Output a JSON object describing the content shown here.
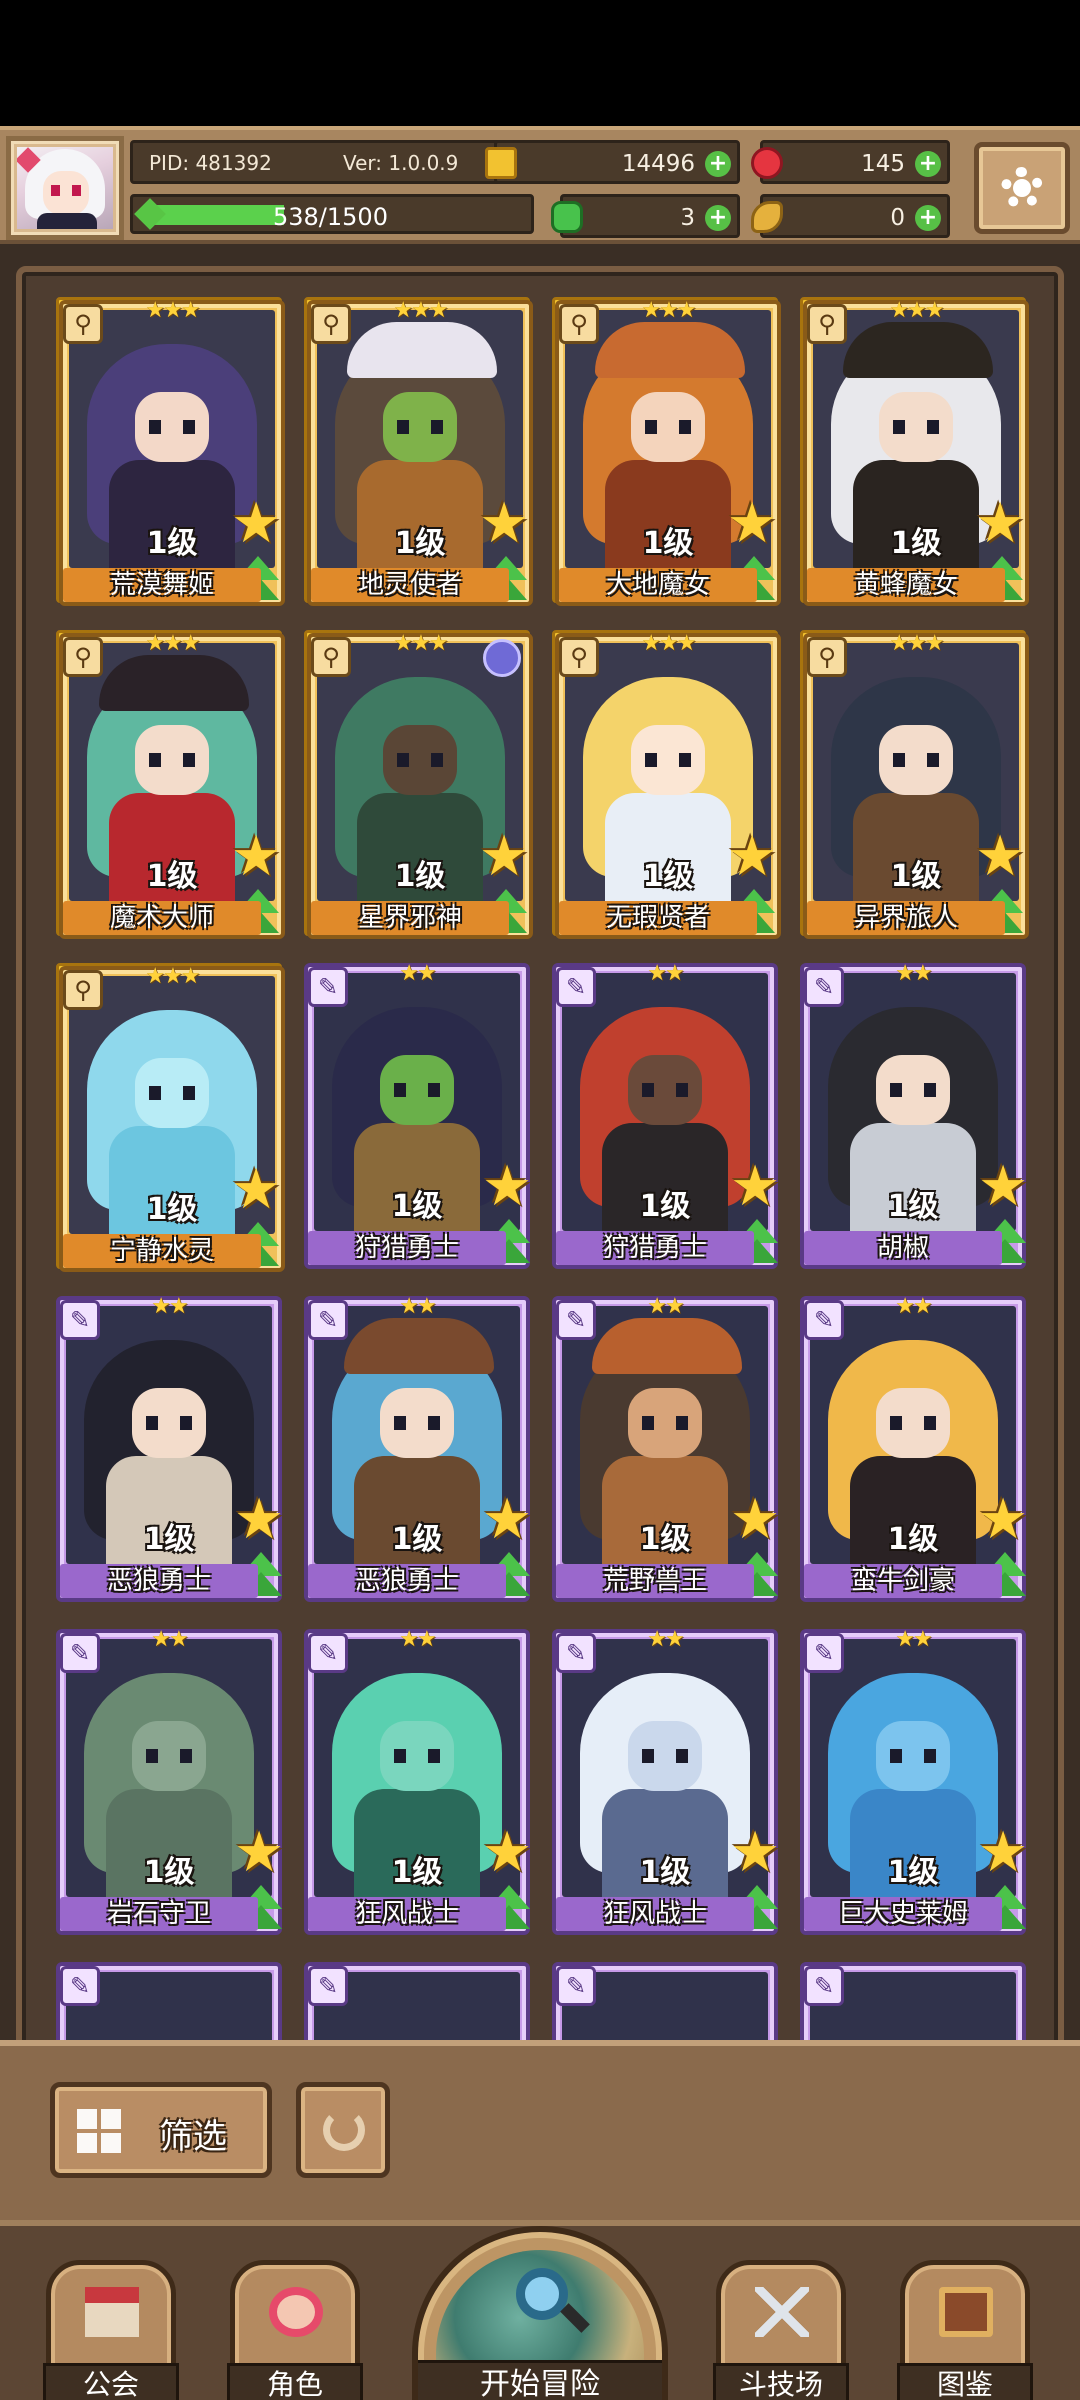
{
  "header": {
    "pid": "PID: 481392",
    "version": "Ver: 1.0.0.9",
    "xp": "538/1500",
    "xp_fraction": 0.359,
    "gold": "14496",
    "ruby": "145",
    "clover": "3",
    "horn": "0"
  },
  "cards": [
    {
      "name": "荒漠舞姬",
      "level": "1级",
      "frame": "gold",
      "stars": "★★★",
      "hair": "#4b3f7a",
      "skin": "#f3d8c8",
      "outfit": "#2d2540",
      "hat": ""
    },
    {
      "name": "地灵使者",
      "level": "1级",
      "frame": "gold",
      "stars": "★★★",
      "hair": "#5b4a3c",
      "skin": "#7fb24a",
      "outfit": "#a86a2e",
      "hat": "#e8e4ee"
    },
    {
      "name": "大地魔女",
      "level": "1级",
      "frame": "gold",
      "stars": "★★★",
      "hair": "#d47a2e",
      "skin": "#f4d4bc",
      "outfit": "#8a3a1e",
      "hat": "#c86a30"
    },
    {
      "name": "黄蜂魔女",
      "level": "1级",
      "frame": "gold",
      "stars": "★★★",
      "hair": "#e8e8ec",
      "skin": "#f3dccb",
      "outfit": "#2a2420",
      "hat": "#2c2620"
    },
    {
      "name": "魔术大师",
      "level": "1级",
      "frame": "gold",
      "stars": "★★★",
      "hair": "#5fb8a0",
      "skin": "#f3dccb",
      "outfit": "#b8282e",
      "hat": "#2a2228"
    },
    {
      "name": "星界邪神",
      "level": "1级",
      "frame": "gold",
      "stars": "★★★",
      "hair": "#3f7a62",
      "skin": "#5a4636",
      "outfit": "#2f4a3a",
      "hat": ""
    },
    {
      "name": "无瑕贤者",
      "level": "1级",
      "frame": "gold",
      "stars": "★★★",
      "hair": "#f4d36a",
      "skin": "#fbe6d4",
      "outfit": "#e8eef6",
      "hat": ""
    },
    {
      "name": "异界旅人",
      "level": "1级",
      "frame": "gold",
      "stars": "★★★",
      "hair": "#2e3648",
      "skin": "#f3dccb",
      "outfit": "#6a4a30",
      "hat": ""
    },
    {
      "name": "宁静水灵",
      "level": "1级",
      "frame": "gold",
      "stars": "★★★",
      "hair": "#8fd8ec",
      "skin": "#b8ecf6",
      "outfit": "#6cc6e0",
      "hat": ""
    },
    {
      "name": "狩猎勇士",
      "level": "1级",
      "frame": "purple",
      "stars": "★★",
      "hair": "#2a2a4a",
      "skin": "#6ab04a",
      "outfit": "#8a6a3a",
      "hat": ""
    },
    {
      "name": "狩猎勇士",
      "level": "1级",
      "frame": "purple",
      "stars": "★★",
      "hair": "#c0402e",
      "skin": "#6a4a3a",
      "outfit": "#2a2628",
      "hat": ""
    },
    {
      "name": "胡椒",
      "level": "1级",
      "frame": "purple",
      "stars": "★★",
      "hair": "#2a2a30",
      "skin": "#f3dccb",
      "outfit": "#c8ccd4",
      "hat": ""
    },
    {
      "name": "恶狼勇士",
      "level": "1级",
      "frame": "purple",
      "stars": "★★",
      "hair": "#22222e",
      "skin": "#f3dccb",
      "outfit": "#d4c8b8",
      "hat": ""
    },
    {
      "name": "恶狼勇士",
      "level": "1级",
      "frame": "purple",
      "stars": "★★",
      "hair": "#5aa8d0",
      "skin": "#f3dccb",
      "outfit": "#6a4a30",
      "hat": "#7a4a2e"
    },
    {
      "name": "荒野兽王",
      "level": "1级",
      "frame": "purple",
      "stars": "★★",
      "hair": "#4a3a30",
      "skin": "#d8a47a",
      "outfit": "#a86a3a",
      "hat": "#b8602e"
    },
    {
      "name": "蛮牛剑豪",
      "level": "1级",
      "frame": "purple",
      "stars": "★★",
      "hair": "#f0b84a",
      "skin": "#f3dccb",
      "outfit": "#2a2224",
      "hat": ""
    },
    {
      "name": "岩石守卫",
      "level": "1级",
      "frame": "purple",
      "stars": "★★",
      "hair": "#6a8a72",
      "skin": "#8aa690",
      "outfit": "#5a7462",
      "hat": ""
    },
    {
      "name": "狂风战士",
      "level": "1级",
      "frame": "purple",
      "stars": "★★",
      "hair": "#5ad0b0",
      "skin": "#7ad6be",
      "outfit": "#2a6a5a",
      "hat": ""
    },
    {
      "name": "狂风战士",
      "level": "1级",
      "frame": "purple",
      "stars": "★★",
      "hair": "#e6eef8",
      "skin": "#cad8ec",
      "outfit": "#5a6a90",
      "hat": ""
    },
    {
      "name": "巨大史莱姆",
      "level": "1级",
      "frame": "purple",
      "stars": "★★",
      "hair": "#4aa6e0",
      "skin": "#7cc4ee",
      "outfit": "#3a86c8",
      "hat": ""
    }
  ],
  "controls": {
    "filter_label": "筛选"
  },
  "nav": {
    "guild": "公会",
    "character": "角色",
    "adventure": "开始冒险",
    "arena": "斗技场",
    "codex": "图鉴"
  },
  "colors": {
    "gold_frame": "#f0c15a",
    "purple_frame": "#c69ae8",
    "accent_green": "#57c046"
  }
}
